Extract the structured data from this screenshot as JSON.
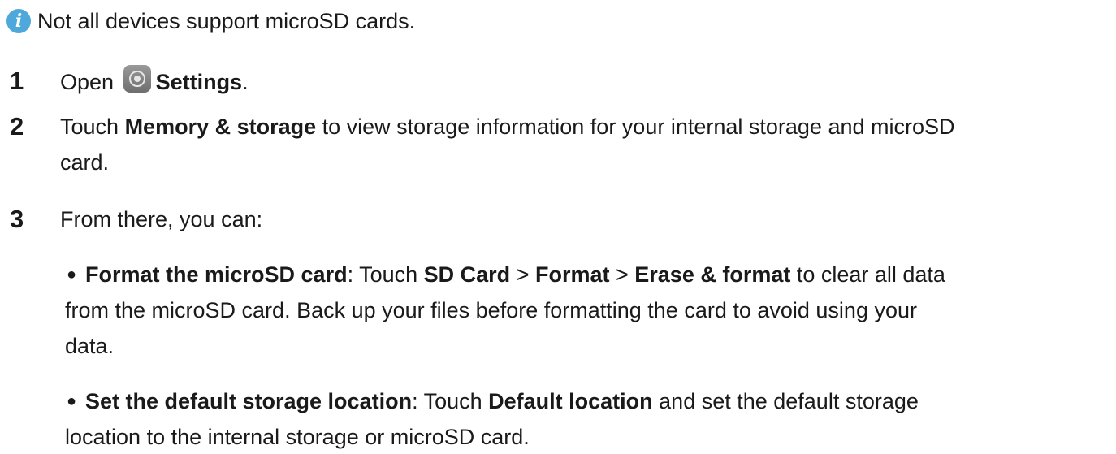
{
  "note": {
    "icon": "info-icon",
    "text": "Not all devices support microSD cards."
  },
  "steps": [
    {
      "num": "1",
      "pre": "Open ",
      "icon": "settings-icon",
      "bold": "Settings",
      "post": "."
    },
    {
      "num": "2",
      "pre": "Touch ",
      "bold": "Memory & storage",
      "post": " to view storage information for your internal storage and microSD",
      "cont": "card."
    },
    {
      "num": "3",
      "text": "From there, you can:"
    }
  ],
  "bullets": [
    {
      "title": "Format the microSD card",
      "t1": ": Touch ",
      "b1": "SD Card",
      "t2": " > ",
      "b2": "Format",
      "t3": " > ",
      "b3": "Erase & format",
      "t4": " to clear all data",
      "line2": "from the microSD card. Back up your files before formatting the card to avoid using your",
      "line3": "data."
    },
    {
      "title": "Set the default storage location",
      "t1": ": Touch ",
      "b1": "Default location",
      "t2": " and set the default storage",
      "line2": "location to the internal storage or microSD card."
    }
  ]
}
